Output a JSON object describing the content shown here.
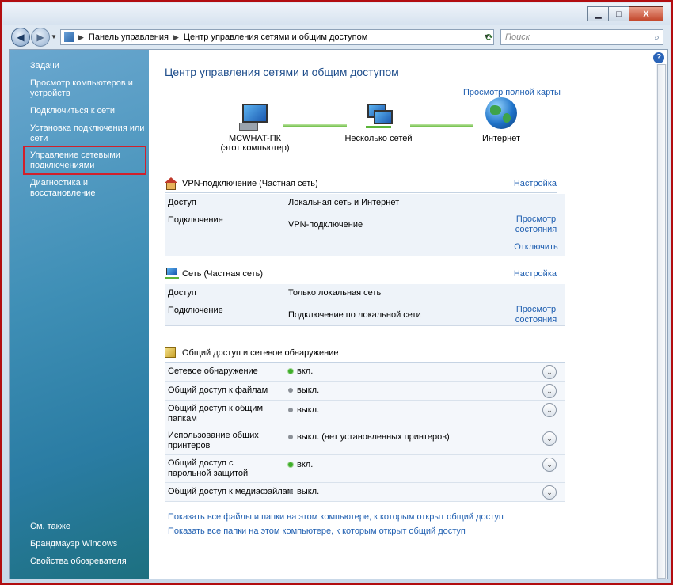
{
  "window": {
    "buttons": [
      "▁",
      "□",
      "X"
    ]
  },
  "address": {
    "segments": [
      "Панель управления",
      "Центр управления сетями и общим доступом"
    ]
  },
  "search": {
    "placeholder": "Поиск"
  },
  "sidebar": {
    "tasks": "Задачи",
    "items": [
      "Просмотр компьютеров и устройств",
      "Подключиться к сети",
      "Установка подключения или сети",
      "Управление сетевыми подключениями",
      "Диагностика и восстановление"
    ],
    "see_also": "См. также",
    "see_also_items": [
      "Брандмауэр Windows",
      "Свойства обозревателя"
    ]
  },
  "main": {
    "title": "Центр управления сетями и общим доступом",
    "full_map": "Просмотр полной карты",
    "nodes": {
      "computer": "MCWHAT-ПК",
      "computer_sub": "(этот компьютер)",
      "networks": "Несколько сетей",
      "internet": "Интернет"
    },
    "vpn": {
      "title": "VPN-подключение (Частная сеть)",
      "settings": "Настройка",
      "access_label": "Доступ",
      "access_value": "Локальная сеть и Интернет",
      "conn_label": "Подключение",
      "conn_value": "VPN-подключение",
      "view_status": "Просмотр состояния",
      "disconnect": "Отключить"
    },
    "net": {
      "title": "Сеть (Частная сеть)",
      "settings": "Настройка",
      "access_label": "Доступ",
      "access_value": "Только локальная сеть",
      "conn_label": "Подключение",
      "conn_value": "Подключение по локальной сети",
      "view_status": "Просмотр состояния"
    },
    "sharing": {
      "title": "Общий доступ и сетевое обнаружение",
      "rows": [
        {
          "label": "Сетевое обнаружение",
          "value": "вкл.",
          "on": true
        },
        {
          "label": "Общий доступ к файлам",
          "value": "выкл.",
          "on": false
        },
        {
          "label": "Общий доступ к общим папкам",
          "value": "выкл.",
          "on": false
        },
        {
          "label": "Использование общих принтеров",
          "value": "выкл. (нет установленных принтеров)",
          "on": false
        },
        {
          "label": "Общий доступ с парольной защитой",
          "value": "вкл.",
          "on": true
        },
        {
          "label": "Общий доступ к медиафайлам",
          "value": "выкл.",
          "on": false
        }
      ]
    },
    "links": [
      "Показать все файлы и папки на этом компьютере, к которым открыт общий доступ",
      "Показать все папки на этом компьютере, к которым открыт общий доступ"
    ]
  }
}
